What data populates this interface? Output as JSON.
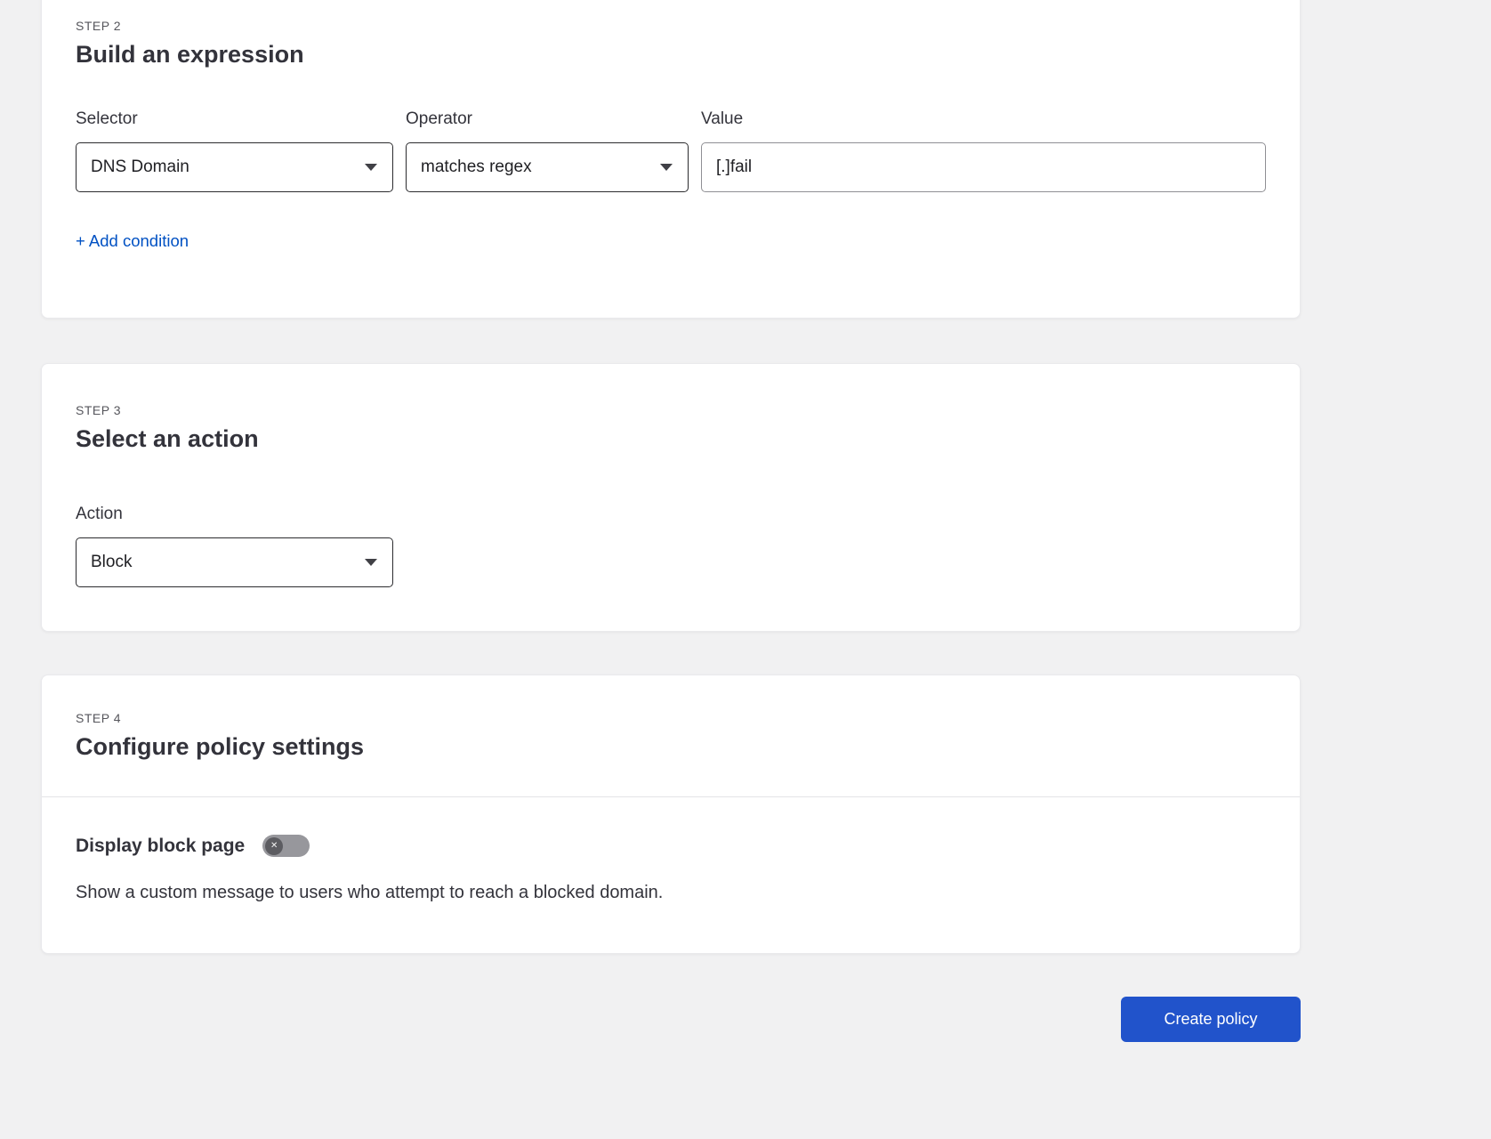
{
  "theme": {
    "page_bg": "#f1f1f2",
    "card_bg": "#ffffff",
    "link_blue": "#0051c3",
    "button_blue": "#2153cb",
    "toggle_off_gray": "#97979c"
  },
  "step2": {
    "step_label": "STEP 2",
    "title": "Build an expression",
    "fields": {
      "selector": {
        "label": "Selector",
        "value": "DNS Domain"
      },
      "operator": {
        "label": "Operator",
        "value": "matches regex"
      },
      "value": {
        "label": "Value",
        "value": "[.]fail"
      }
    },
    "add_condition": "+ Add condition"
  },
  "step3": {
    "step_label": "STEP 3",
    "title": "Select an action",
    "action": {
      "label": "Action",
      "value": "Block"
    }
  },
  "step4": {
    "step_label": "STEP 4",
    "title": "Configure policy settings",
    "block_page": {
      "label": "Display block page",
      "toggle_state": "off",
      "toggle_glyph": "✕",
      "description": "Show a custom message to users who attempt to reach a blocked domain."
    }
  },
  "footer": {
    "create_button": "Create policy"
  }
}
